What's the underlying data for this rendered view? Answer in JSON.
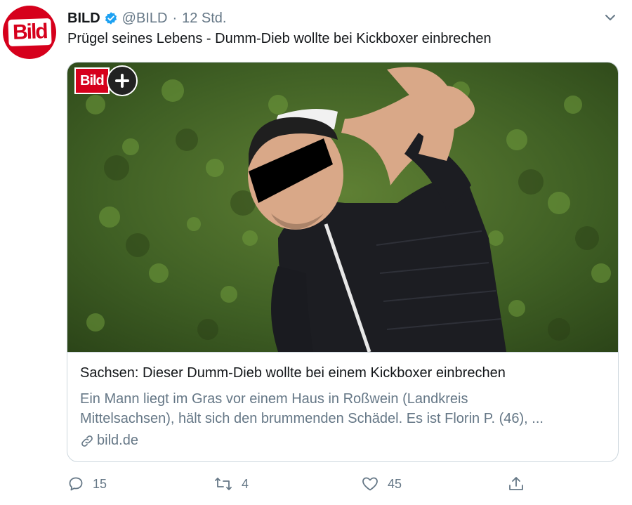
{
  "tweet": {
    "author_name": "BILD",
    "handle": "@BILD",
    "separator": "·",
    "time": "12 Std.",
    "avatar_logo": "Bild",
    "text": "Prügel seines Lebens - Dumm-Dieb wollte bei Kickboxer einbrechen",
    "icons": {
      "verified": "verified-badge-icon",
      "menu": "chevron-down-icon"
    }
  },
  "card": {
    "badge_logo": "Bild",
    "badge_icon": "plus-icon",
    "image_description_colors": {
      "hedge": "#4a6a2a",
      "vest": "#1c1d22"
    },
    "title": "Sachsen: Dieser Dumm-Dieb wollte bei einem Kickboxer einbrechen",
    "description_line1": "Ein Mann liegt im Gras vor einem Haus in Roßwein (Landkreis",
    "description_line2": "Mittelsachsen), hält sich den brummenden Schädel. Es ist Florin P. (46), ...",
    "domain": "bild.de"
  },
  "actions": {
    "reply_count": "15",
    "retweet_count": "4",
    "like_count": "45"
  },
  "colors": {
    "brand_red": "#d6001c",
    "verified_blue": "#1da1f2",
    "muted": "#657786",
    "border": "#ccd6dd"
  }
}
